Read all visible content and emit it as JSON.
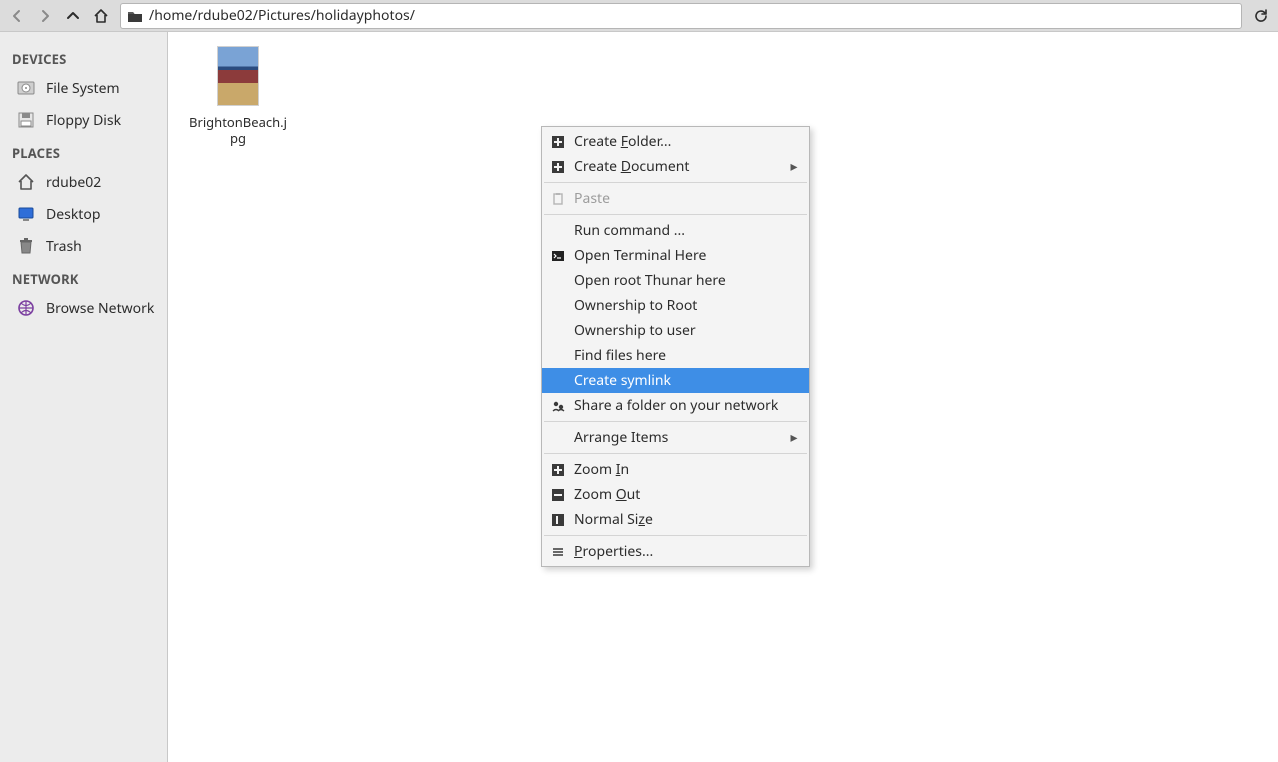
{
  "location": {
    "path": "/home/rdube02/Pictures/holidayphotos/"
  },
  "sidebar": {
    "sections": {
      "devices": {
        "header": "DEVICES",
        "items": [
          {
            "label": "File System"
          },
          {
            "label": "Floppy Disk"
          }
        ]
      },
      "places": {
        "header": "PLACES",
        "items": [
          {
            "label": "rdube02"
          },
          {
            "label": "Desktop"
          },
          {
            "label": "Trash"
          }
        ]
      },
      "network": {
        "header": "NETWORK",
        "items": [
          {
            "label": "Browse Network"
          }
        ]
      }
    }
  },
  "files": [
    {
      "name": "BrightonBeach.j\npg"
    }
  ],
  "contextmenu": {
    "items": [
      {
        "label_pre": "Create ",
        "label_u": "F",
        "label_post": "older...",
        "icon": "plus",
        "submenu": false
      },
      {
        "label_pre": "Create ",
        "label_u": "D",
        "label_post": "ocument",
        "icon": "plus",
        "submenu": true
      },
      {
        "sep": true
      },
      {
        "label_pre": "Paste",
        "label_u": "",
        "label_post": "",
        "icon": "clipboard",
        "disabled": true
      },
      {
        "sep": true
      },
      {
        "label_pre": "Run command ...",
        "label_u": "",
        "label_post": ""
      },
      {
        "label_pre": "Open Terminal Here",
        "label_u": "",
        "label_post": "",
        "icon": "terminal"
      },
      {
        "label_pre": "Open root Thunar here",
        "label_u": "",
        "label_post": ""
      },
      {
        "label_pre": "Ownership to Root",
        "label_u": "",
        "label_post": ""
      },
      {
        "label_pre": "Ownership to user",
        "label_u": "",
        "label_post": ""
      },
      {
        "label_pre": "Find files here",
        "label_u": "",
        "label_post": ""
      },
      {
        "label_pre": "Create symlink",
        "label_u": "",
        "label_post": "",
        "highlight": true
      },
      {
        "label_pre": "Share a folder on your network",
        "label_u": "",
        "label_post": "",
        "icon": "share"
      },
      {
        "sep": true
      },
      {
        "label_pre": "Arrange Items",
        "label_u": "",
        "label_post": "",
        "submenu": true
      },
      {
        "sep": true
      },
      {
        "label_pre": "Zoom ",
        "label_u": "I",
        "label_post": "n",
        "icon": "zoomplus"
      },
      {
        "label_pre": "Zoom ",
        "label_u": "O",
        "label_post": "ut",
        "icon": "zoomminus"
      },
      {
        "label_pre": "Normal Si",
        "label_u": "z",
        "label_post": "e",
        "icon": "normalsize"
      },
      {
        "sep": true
      },
      {
        "label_pre": "",
        "label_u": "P",
        "label_post": "roperties...",
        "icon": "properties"
      }
    ]
  }
}
